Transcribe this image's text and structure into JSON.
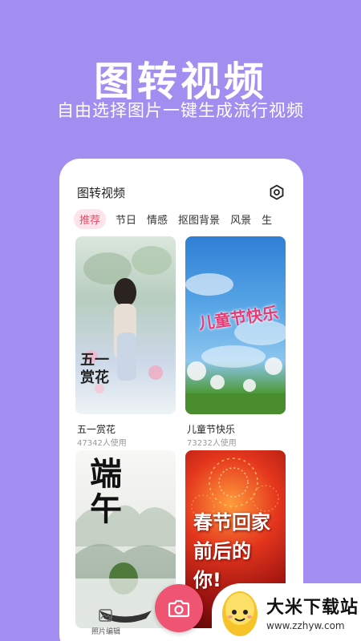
{
  "hero": {
    "title": "图转视频",
    "subtitle": "自由选择图片一键生成流行视频"
  },
  "app": {
    "title": "图转视频",
    "settings_icon": "hexagon-settings-icon"
  },
  "tabs": [
    {
      "label": "推荐",
      "active": true
    },
    {
      "label": "节日",
      "active": false
    },
    {
      "label": "情感",
      "active": false
    },
    {
      "label": "抠图背景",
      "active": false
    },
    {
      "label": "风景",
      "active": false
    },
    {
      "label": "生",
      "active": false
    }
  ],
  "templates": [
    {
      "name": "五一赏花",
      "uses": "47342人使用",
      "overlay": "五一\n赏花"
    },
    {
      "name": "儿童节快乐",
      "uses": "73232人使用",
      "overlay": "儿童节快乐"
    },
    {
      "name": "",
      "uses": "",
      "overlay": "端\n午"
    },
    {
      "name": "",
      "uses": "",
      "overlay": "春节回家\n前后的\n你!"
    }
  ],
  "bottom_nav": {
    "photo_edit_label": "照片编辑"
  },
  "watermark": {
    "title": "大米下载站",
    "url": "www.zzhyw.com"
  },
  "colors": {
    "background": "#a18ef0",
    "accent": "#f05473",
    "active_tab_bg": "#fde4ea"
  }
}
